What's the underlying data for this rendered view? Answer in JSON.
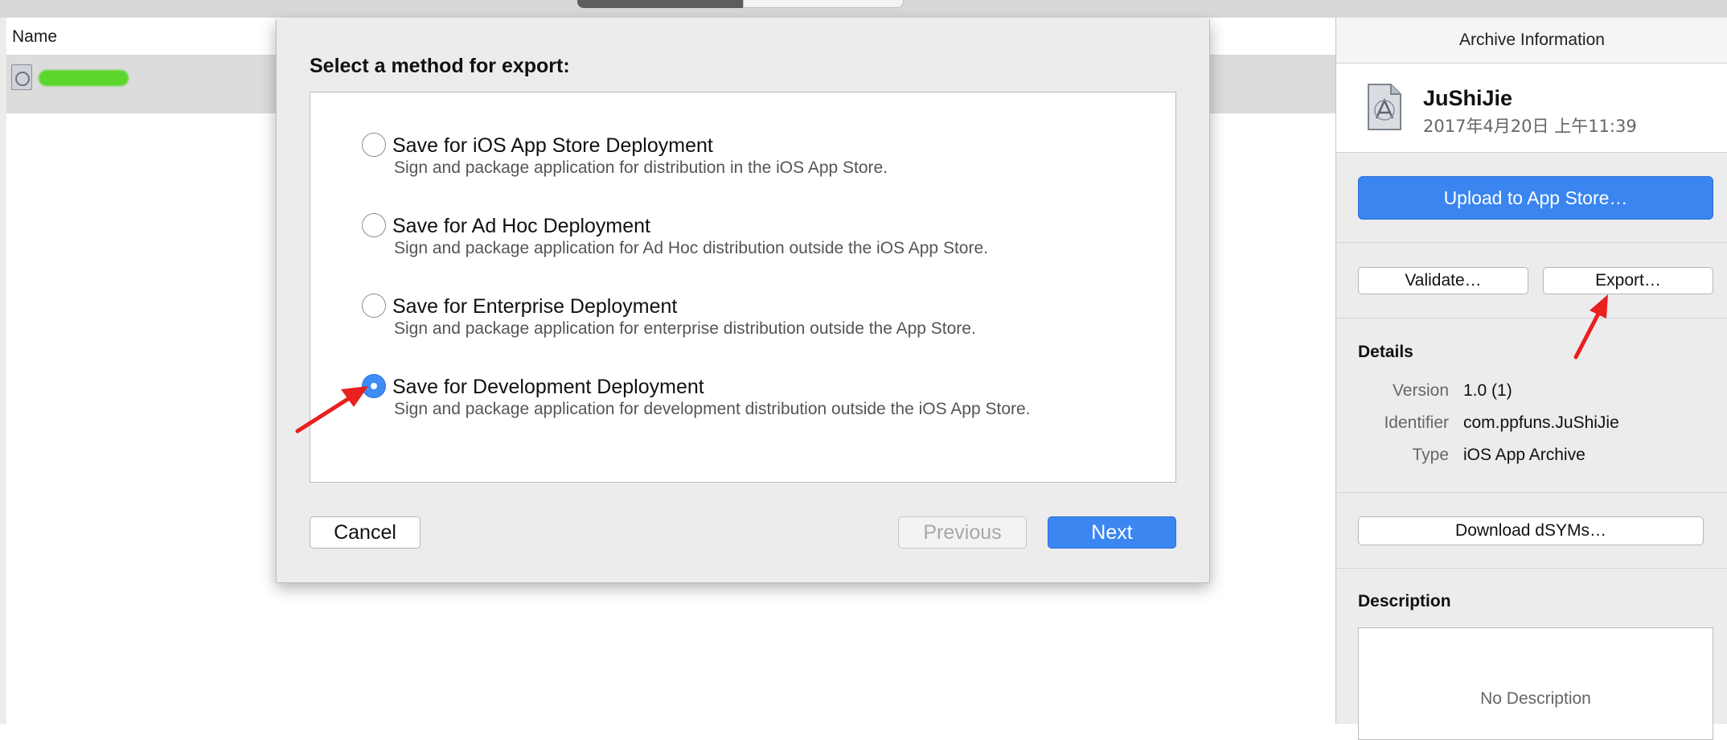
{
  "colors": {
    "accent_blue": "#3b86f0",
    "annotation_red": "#e8201e",
    "redacted_green": "#5ad62a"
  },
  "list": {
    "column_header": "Name"
  },
  "sheet": {
    "title": "Select a method for export:",
    "options": [
      {
        "title": "Save for iOS App Store Deployment",
        "description": "Sign and package application for distribution in the iOS App Store.",
        "selected": false
      },
      {
        "title": "Save for Ad Hoc Deployment",
        "description": "Sign and package application for Ad Hoc distribution outside the iOS App Store.",
        "selected": false
      },
      {
        "title": "Save for Enterprise Deployment",
        "description": "Sign and package application for enterprise distribution outside the App Store.",
        "selected": false
      },
      {
        "title": "Save for Development Deployment",
        "description": "Sign and package application for development distribution outside the iOS App Store.",
        "selected": true
      }
    ],
    "buttons": {
      "cancel": "Cancel",
      "previous": "Previous",
      "next": "Next"
    }
  },
  "inspector": {
    "title": "Archive Information",
    "app_name": "JuShiJie",
    "app_date": "2017年4月20日 上午11:39",
    "upload_label": "Upload to App Store…",
    "validate_label": "Validate…",
    "export_label": "Export…",
    "details_heading": "Details",
    "details": [
      {
        "key": "Version",
        "value": "1.0 (1)"
      },
      {
        "key": "Identifier",
        "value": "com.ppfuns.JuShiJie"
      },
      {
        "key": "Type",
        "value": "iOS App Archive"
      }
    ],
    "dsyms_label": "Download dSYMs…",
    "description_heading": "Description",
    "description_placeholder": "No Description"
  }
}
